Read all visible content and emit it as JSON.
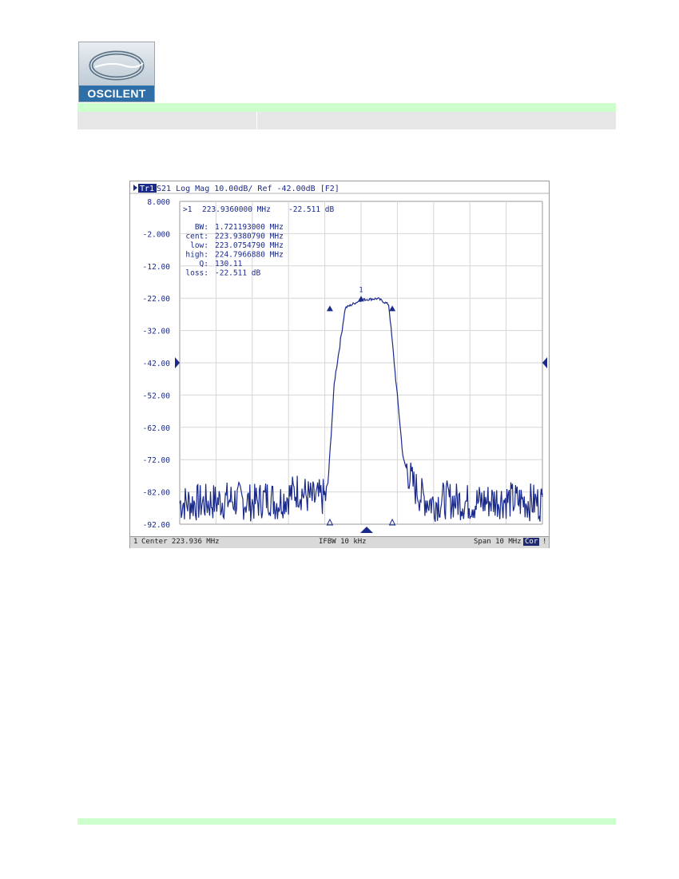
{
  "logo": {
    "text": "OSCILENT"
  },
  "analyzer": {
    "title": {
      "trace": "Tr1",
      "rest": " S21 Log Mag 10.00dB/ Ref -42.00dB [F2]"
    },
    "marker": {
      "label": ">1",
      "freq": "223.9360000 MHz",
      "value": "-22.511 dB",
      "flag": "1"
    },
    "bw_stats": [
      {
        "key": "BW:",
        "value": "1.721193000 MHz"
      },
      {
        "key": "cent:",
        "value": "223.9380790 MHz"
      },
      {
        "key": "low:",
        "value": "223.0754790 MHz"
      },
      {
        "key": "high:",
        "value": "224.7966880 MHz"
      },
      {
        "key": "Q:",
        "value": "130.11"
      },
      {
        "key": "loss:",
        "value": "-22.511 dB"
      }
    ],
    "status": {
      "channel": "1",
      "center": "Center 223.936 MHz",
      "ifbw": "IFBW 10 kHz",
      "span": "Span 10 MHz",
      "cor": "Cor",
      "end": "!"
    },
    "right_label": "1"
  },
  "chart_data": {
    "type": "line",
    "title": "",
    "xlabel": "",
    "ylabel": "",
    "y_ticks": [
      "8.000",
      "-2.000",
      "-12.00",
      "-22.00",
      "-32.00",
      "-42.00",
      "-52.00",
      "-62.00",
      "-72.00",
      "-82.00",
      "-92.00"
    ],
    "ylim": [
      -92,
      8
    ],
    "xlim": [
      218.936,
      228.936
    ],
    "x_unit": "MHz",
    "grid": true,
    "reference_level": -42,
    "series": [
      {
        "x": [
          218.936,
          219.6,
          220.4,
          221.0,
          221.4,
          221.6,
          221.9,
          222.2,
          222.6,
          223.0,
          223.2,
          223.5,
          223.94,
          224.4,
          224.7,
          224.9,
          225.1,
          225.35,
          225.6,
          225.9,
          226.3,
          227.0,
          227.8,
          228.936
        ],
        "y": [
          -86,
          -86,
          -85,
          -86,
          -84,
          -86,
          -84,
          -82,
          -85,
          -84,
          -48,
          -25,
          -22.5,
          -22.1,
          -24,
          -48,
          -72,
          -80,
          -84,
          -86,
          -85,
          -86,
          -85,
          -86
        ]
      }
    ],
    "markers": [
      {
        "x": 223.936,
        "y": -22.511,
        "label": "1"
      },
      {
        "x": 223.0755,
        "y": -25.5
      },
      {
        "x": 224.7967,
        "y": -25.5
      }
    ]
  }
}
